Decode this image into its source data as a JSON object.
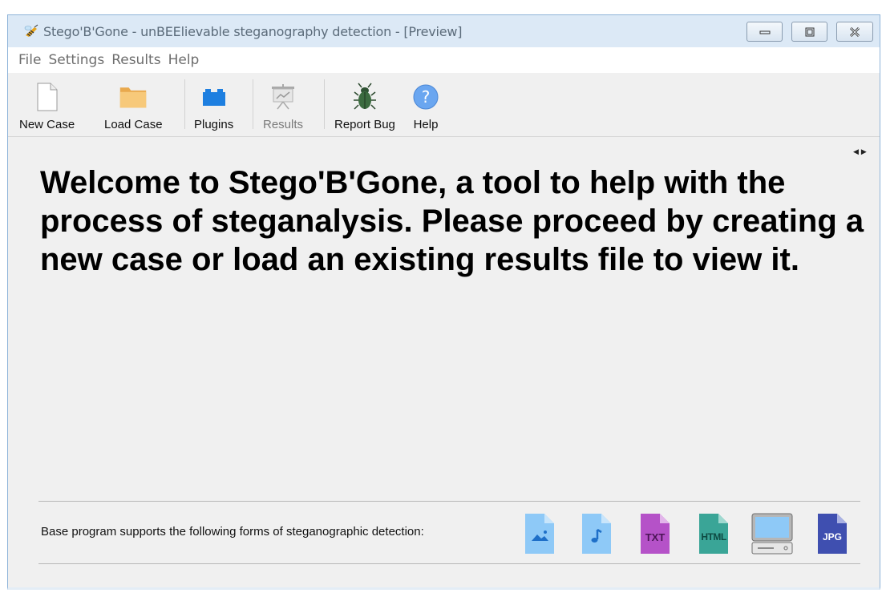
{
  "window": {
    "title": "Stego'B'Gone - unBEElievable steganography detection - [Preview]"
  },
  "menu": [
    "File",
    "Settings",
    "Results",
    "Help"
  ],
  "toolbar": {
    "new_case": "New Case",
    "load_case": "Load Case",
    "plugins": "Plugins",
    "results": "Results",
    "report_bug": "Report Bug",
    "help": "Help"
  },
  "main": {
    "welcome": "Welcome to Stego'B'Gone, a tool to help with the process of steganalysis. Please proceed by creating a new case or load an existing results file to view it.",
    "supports_text": "Base program supports the following forms of steganographic detection:",
    "formats": [
      {
        "icon": "image-file-icon",
        "label": ""
      },
      {
        "icon": "audio-file-icon",
        "label": ""
      },
      {
        "icon": "txt-file-icon",
        "label": "TXT"
      },
      {
        "icon": "html-file-icon",
        "label": "HTML"
      },
      {
        "icon": "computer-icon",
        "label": ""
      },
      {
        "icon": "jpg-file-icon",
        "label": "JPG"
      }
    ]
  },
  "colors": {
    "titlebar": "#dce9f6",
    "folder": "#f5c270",
    "plugin_blue": "#1e7fe0",
    "help_blue": "#6aa6f0",
    "file_lightblue": "#8ec9f7",
    "txt_purple": "#b552c8",
    "html_teal": "#3aa597",
    "jpg_indigo": "#3f4fb0"
  }
}
